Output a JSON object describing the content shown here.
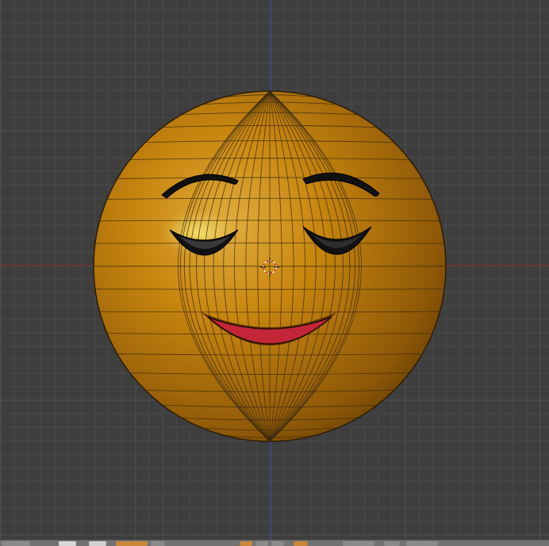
{
  "app": "3D viewport",
  "viewport": {
    "background": "#3e3e3e",
    "grid_minor": "#4a4a4a",
    "grid_major": "#545454",
    "x_axis_color": "#8e3b3b",
    "y_axis_color": "#4a4ab4"
  },
  "model": {
    "name": "emoji-face",
    "body_color": "#c8860f",
    "wire_color": "#3a2a10",
    "eye_color": "#101010",
    "mouth_color": "#c42638"
  },
  "header": {
    "icons": [
      "object-mode-icon",
      "viewport-shading-icon",
      "pivot-icon",
      "manipulator-icon",
      "vertex-select-icon",
      "edge-select-icon",
      "face-select-icon",
      "limit-selection-icon",
      "proportional-edit-icon",
      "snap-icon",
      "render-icon"
    ]
  }
}
